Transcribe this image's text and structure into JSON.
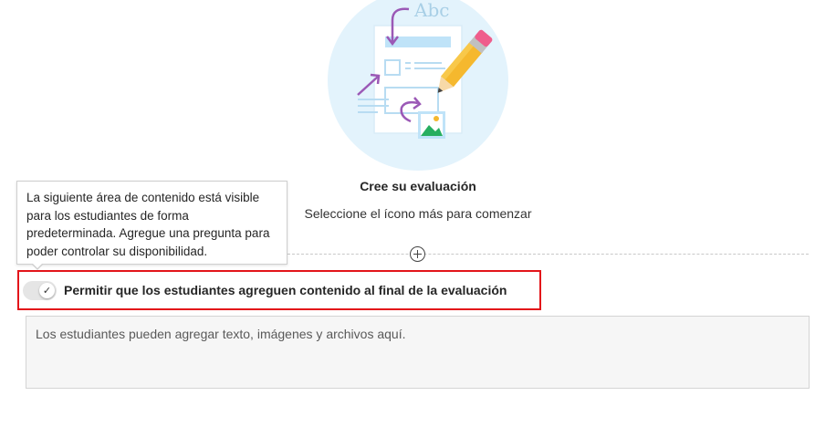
{
  "illustration": {
    "caption_text": "Abc",
    "colors": {
      "circle": "#e3f3fc",
      "paper": "#ffffff",
      "accent": "#bfe3f8",
      "arrow": "#9b59b6",
      "pencil": "#f5b82e",
      "eraser": "#ef5d8c"
    }
  },
  "empty_state": {
    "title": "Cree su evaluación",
    "subtitle": "Seleccione el ícono más para comenzar"
  },
  "add_button_icon": "plus-circle-icon",
  "tooltip": {
    "text": "La siguiente área de contenido está visible para los estudiantes de forma predeterminada. Agregue una pregunta para poder controlar su disponibilidad."
  },
  "toggle": {
    "state": "on",
    "icon": "checkmark-icon",
    "label": "Permitir que los estudiantes agreguen contenido al final de la evaluación"
  },
  "highlight_color": "#e3151a",
  "student_content": {
    "placeholder": "Los estudiantes pueden agregar texto, imágenes y archivos aquí."
  }
}
